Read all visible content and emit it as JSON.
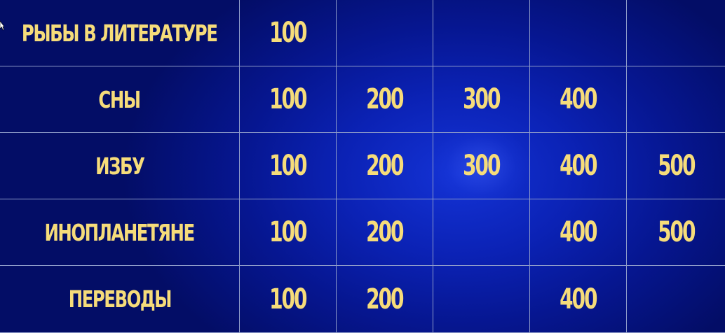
{
  "board": {
    "rows": [
      {
        "category": "РЫБЫ В ЛИТЕРАТУРЕ",
        "values": [
          "100",
          "",
          "",
          "",
          ""
        ]
      },
      {
        "category": "СНЫ",
        "values": [
          "100",
          "200",
          "300",
          "400",
          ""
        ]
      },
      {
        "category": "ИЗБУ",
        "values": [
          "100",
          "200",
          "300",
          "400",
          "500"
        ]
      },
      {
        "category": "ИНОПЛАНЕТЯНЕ",
        "values": [
          "100",
          "200",
          "",
          "400",
          "500"
        ]
      },
      {
        "category": "ПЕРЕВОДЫ",
        "values": [
          "100",
          "200",
          "",
          "400",
          ""
        ]
      }
    ]
  },
  "colors": {
    "text": "#f6dc7a",
    "grid": "#8f9cc9",
    "background": "#061690"
  }
}
